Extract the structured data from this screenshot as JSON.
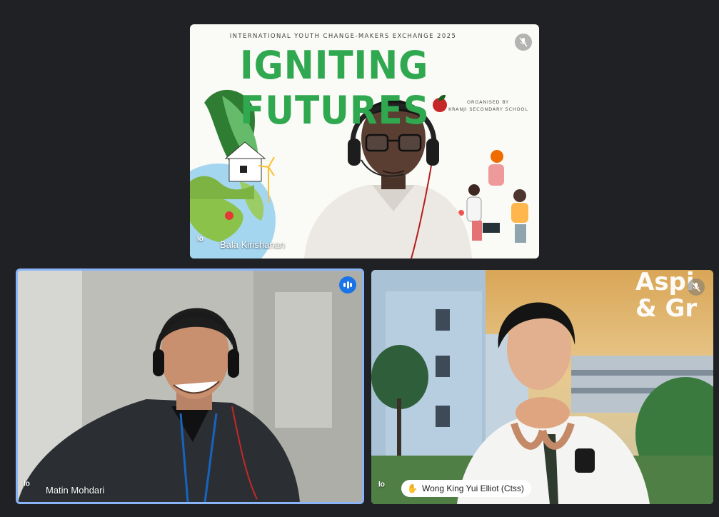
{
  "participants": [
    {
      "name": "Bala Kirishanan",
      "muted": true,
      "pinned": false
    },
    {
      "name": "Matin Mohdari",
      "muted": false,
      "speaking": true
    },
    {
      "name": "Wong King Yui Elliot (Ctss)",
      "muted": true,
      "hand_raised": true
    }
  ],
  "presentation": {
    "event_line": "INTERNATIONAL YOUTH CHANGE-MAKERS EXCHANGE 2025",
    "title": "IGNITING FUTURES",
    "organised_by": "ORGANISED BY",
    "school": "KRANJI SECONDARY SCHOOL"
  },
  "backdrop_text": {
    "line1": "Aspi",
    "line2": "& Gr"
  },
  "colors": {
    "speaking_border": "#8ab4f8",
    "speaking_badge": "#1a73e8",
    "title_green": "#2fa84f"
  }
}
